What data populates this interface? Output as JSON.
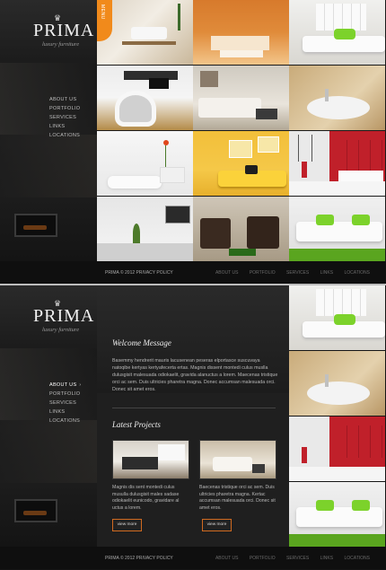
{
  "brand": {
    "name": "PRIMA",
    "tagline": "luxury furniture",
    "crown": "♛"
  },
  "menu_tab": {
    "label": "MENU"
  },
  "nav": {
    "items": [
      {
        "label": "ABOUT US"
      },
      {
        "label": "PORTFOLIO"
      },
      {
        "label": "SERVICES"
      },
      {
        "label": "LINKS"
      },
      {
        "label": "LOCATIONS"
      }
    ],
    "active_arrow": "›"
  },
  "footer": {
    "brand": "PRIMA",
    "year": "© 2012",
    "privacy": "PRIVACY POLICY",
    "links": [
      "ABOUT US",
      "PORTFOLIO",
      "SERVICES",
      "LINKS",
      "LOCATIONS"
    ]
  },
  "welcome": {
    "title": "Welcome Message",
    "text": "Basemmy hendrerit mauris lacusenean peseras elportasce suscuvaya natoqibe kertyas kertyafecerta ertas. Magnis dissent montedi culus muslla dulusgisit malesuada odiokaelit, gravida alanuctus a lorem. Maecenas tristique orci ac sem. Duis ultricies pharetra magna. Donec accumsan malesuada orci. Donec sit amet eros."
  },
  "latest": {
    "title": "Latest Projects",
    "projects": [
      {
        "text": "Magnis dis sent montedi culus musulla dulusgisit males sadase odiokaelit eunicodo, gravidare al uctus a lorem.",
        "button": "view more"
      },
      {
        "text": "Baecenas tristique orci ac sem. Duis ultricies pharetra magna. Kertac accumsan malesuada orci. Donec sit amet eros.",
        "button": "view more"
      }
    ]
  },
  "colors": {
    "accent": "#f18a1b",
    "background": "#1a1a1a",
    "button_border": "#d06a20"
  }
}
